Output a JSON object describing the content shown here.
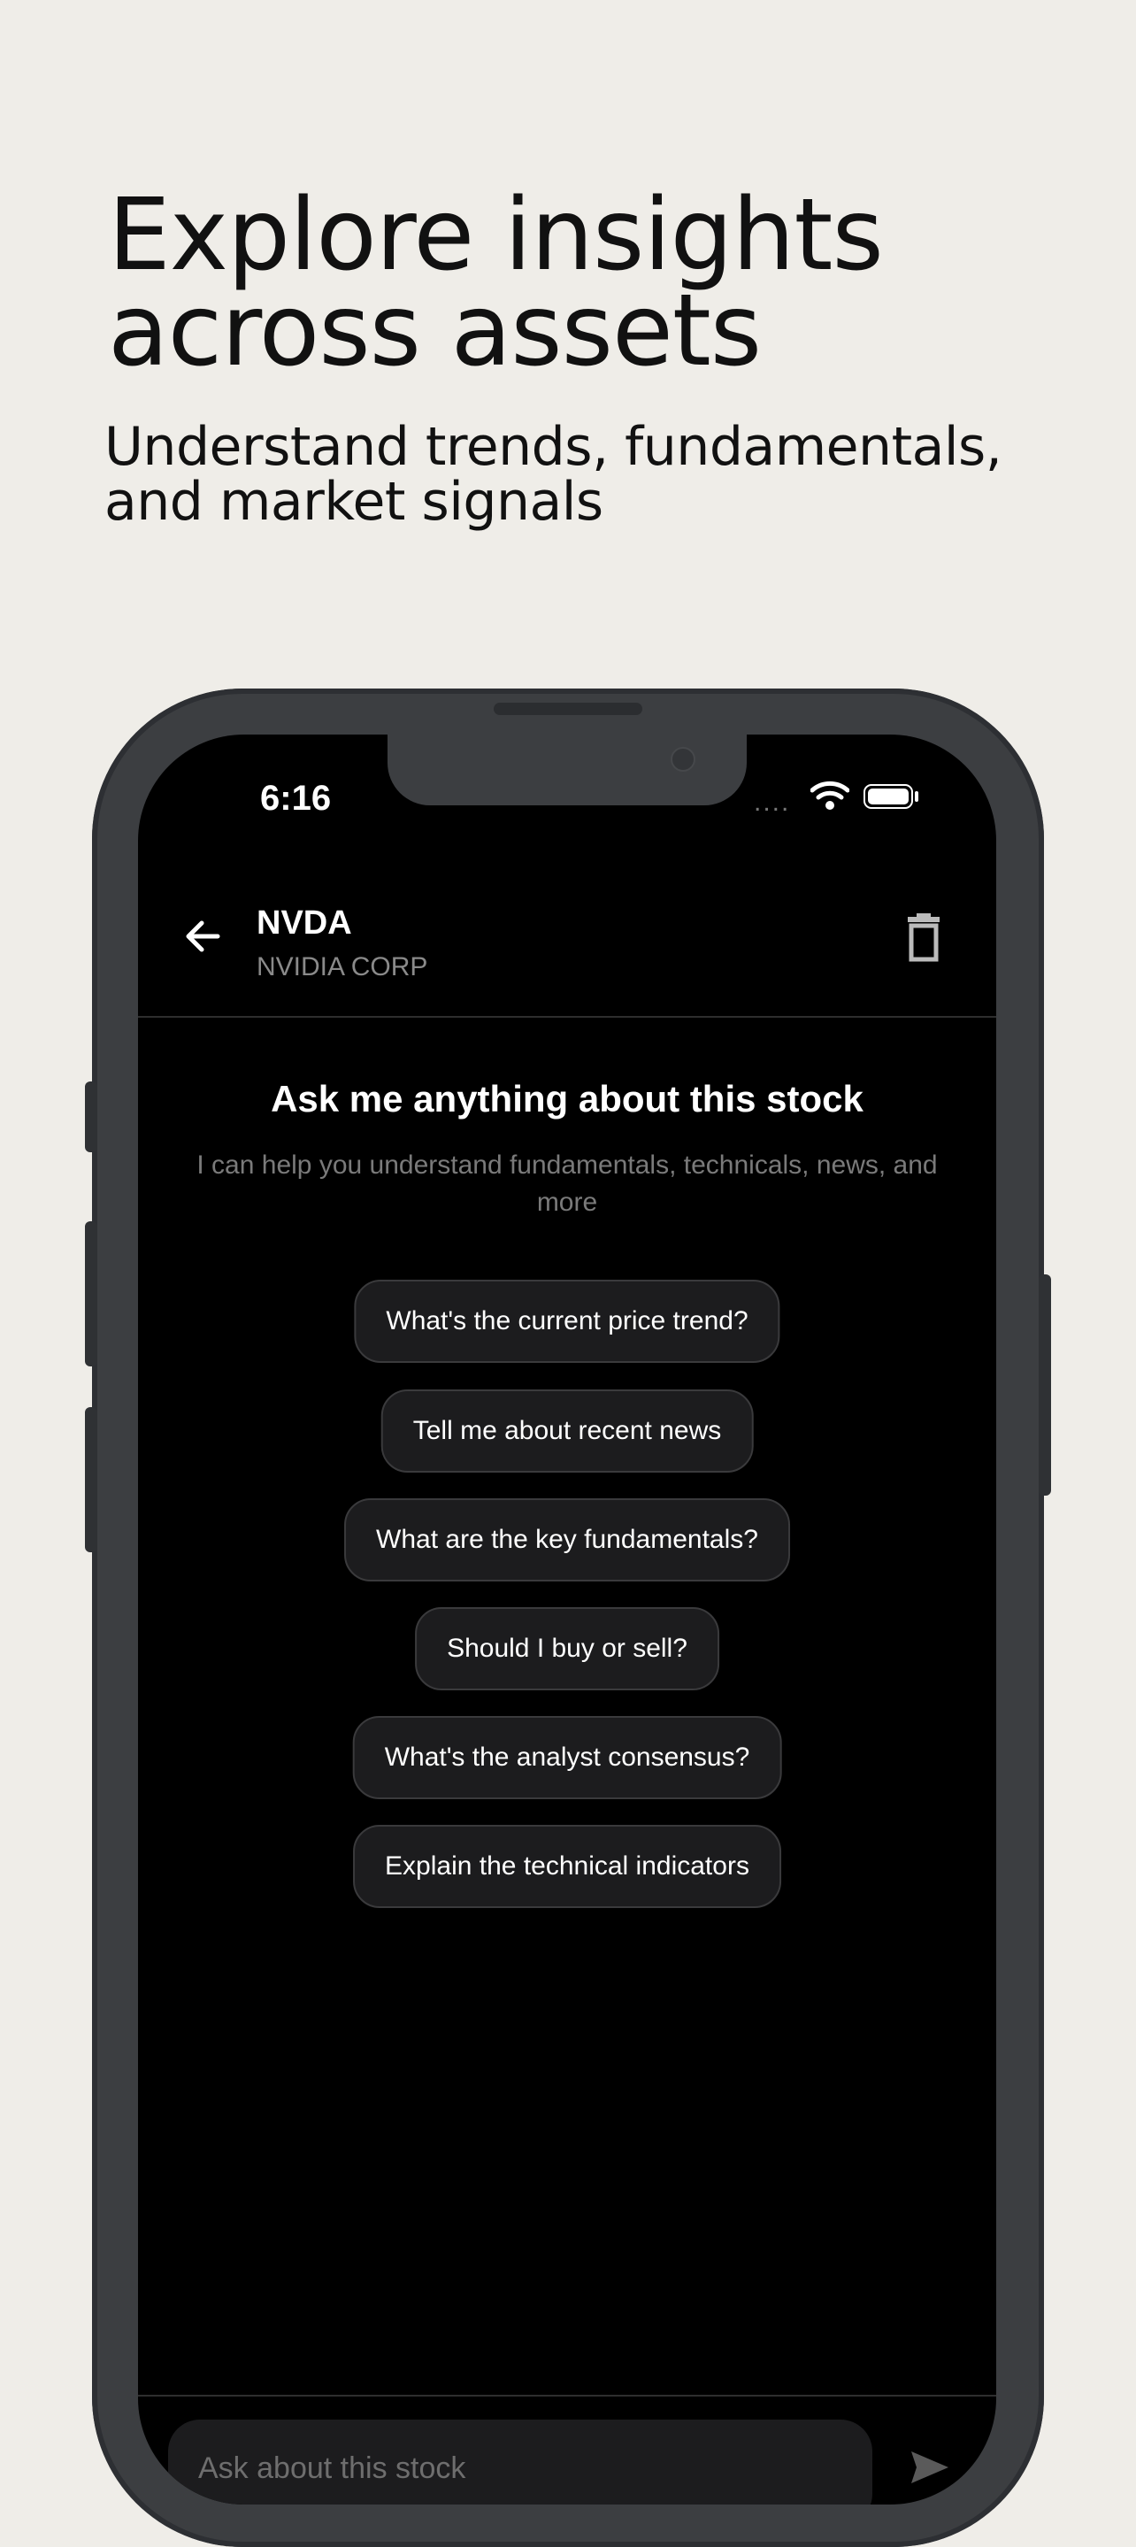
{
  "promo": {
    "headline": "Explore insights across assets",
    "subheadline": "Understand trends, fundamentals, and market signals"
  },
  "status_bar": {
    "time": "6:16",
    "dots": "....",
    "wifi_icon": "wifi-icon",
    "battery_icon": "battery-icon"
  },
  "header": {
    "ticker": "NVDA",
    "company": "NVIDIA CORP",
    "back_icon": "arrow-left-icon",
    "delete_icon": "trash-icon"
  },
  "empty_state": {
    "title": "Ask me anything about this stock",
    "subtitle": "I can help you understand fundamentals, technicals, news, and more"
  },
  "suggestions": [
    "What's the current price trend?",
    "Tell me about recent news",
    "What are the key fundamentals?",
    "Should I buy or sell?",
    "What's the analyst consensus?",
    "Explain the technical indicators"
  ],
  "composer": {
    "placeholder": "Ask about this stock",
    "send_icon": "send-icon"
  }
}
